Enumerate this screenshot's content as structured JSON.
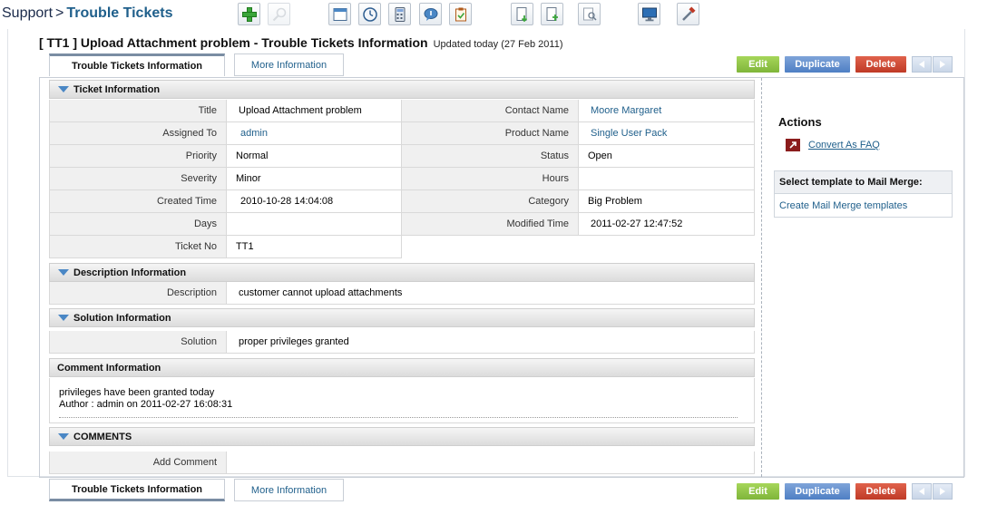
{
  "breadcrumb": {
    "module": "Support",
    "separator": ">",
    "current": "Trouble Tickets"
  },
  "toolbar": {
    "icons": [
      "add-icon",
      "search-icon",
      "calendar-icon",
      "clock-icon",
      "calculator-icon",
      "chat-icon",
      "clipboard-icon",
      "import-icon",
      "export-icon",
      "find-duplicates-icon",
      "monitor-icon",
      "settings-tools-icon"
    ]
  },
  "record": {
    "title": "[ TT1 ] Upload Attachment problem - Trouble Tickets Information",
    "updated": "Updated today (27 Feb 2011)"
  },
  "tabs": {
    "main": "Trouble Tickets Information",
    "more": "More Information"
  },
  "buttons": {
    "edit": "Edit",
    "duplicate": "Duplicate",
    "delete": "Delete"
  },
  "ticket_info": {
    "header": "Ticket Information",
    "left": [
      {
        "label": "Title",
        "value": "Upload Attachment problem",
        "link": false
      },
      {
        "label": "Assigned To",
        "value": "admin",
        "link": true
      },
      {
        "label": "Priority",
        "value": "Normal",
        "link": false
      },
      {
        "label": "Severity",
        "value": "Minor",
        "link": false
      },
      {
        "label": "Created Time",
        "value": "2010-10-28 14:04:08",
        "link": false
      },
      {
        "label": "Days",
        "value": "",
        "link": false
      },
      {
        "label": "Ticket No",
        "value": "TT1",
        "link": false
      }
    ],
    "right": [
      {
        "label": "Contact Name",
        "value": "Moore Margaret",
        "link": true
      },
      {
        "label": "Product Name",
        "value": "Single User Pack",
        "link": true
      },
      {
        "label": "Status",
        "value": "Open",
        "link": false
      },
      {
        "label": "Hours",
        "value": "",
        "link": false
      },
      {
        "label": "Category",
        "value": "Big Problem",
        "link": false
      },
      {
        "label": "Modified Time",
        "value": "2011-02-27 12:47:52",
        "link": false
      }
    ]
  },
  "description": {
    "header": "Description Information",
    "label": "Description",
    "value": "customer cannot upload attachments"
  },
  "solution": {
    "header": "Solution Information",
    "label": "Solution",
    "value": "proper privileges granted"
  },
  "comments_info": {
    "header": "Comment Information",
    "text": "privileges have been granted today",
    "author": "Author : admin on 2011-02-27 16:08:31"
  },
  "comments": {
    "header": "COMMENTS",
    "label": "Add Comment"
  },
  "sidebar": {
    "actions_title": "Actions",
    "convert_faq": "Convert As FAQ",
    "mail_merge_title": "Select template to Mail Merge:",
    "mail_merge_link": "Create Mail Merge templates"
  },
  "colors": {
    "link": "#1f5f8b",
    "edit": "#7fb53a",
    "duplicate": "#4e7fc4",
    "delete": "#bf3a26",
    "section_triangle": "#4a87c5"
  }
}
